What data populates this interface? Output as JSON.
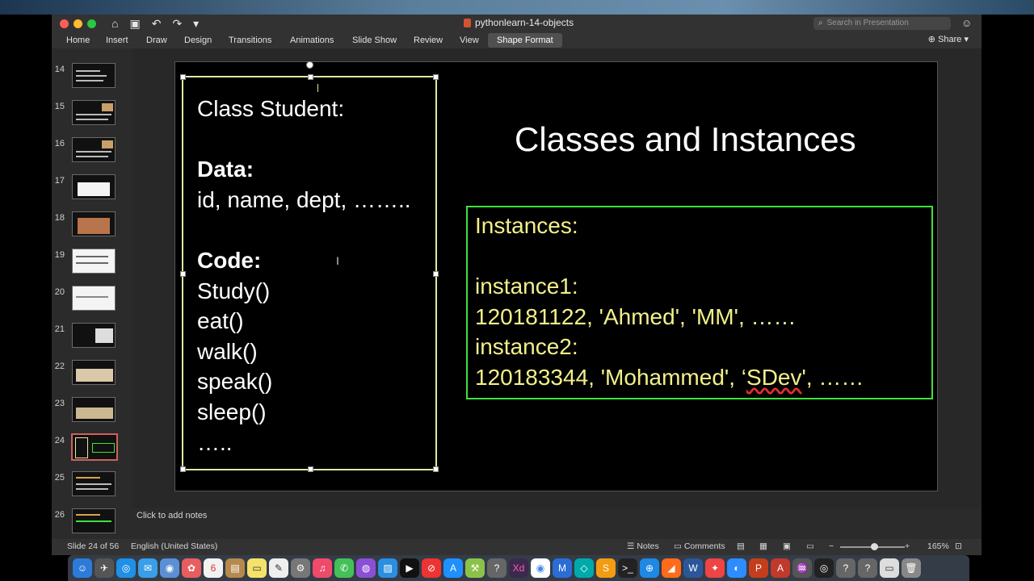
{
  "window": {
    "title": "pythonlearn-14-objects",
    "search_placeholder": "Search in Presentation",
    "share_label": "Share"
  },
  "quick_access": [
    "⌂",
    "▣",
    "↶",
    "↷",
    "▾"
  ],
  "tabs": [
    "Home",
    "Insert",
    "Draw",
    "Design",
    "Transitions",
    "Animations",
    "Slide Show",
    "Review",
    "View",
    "Shape Format"
  ],
  "active_tab": "Shape Format",
  "thumbnails": [
    {
      "num": "14"
    },
    {
      "num": "15"
    },
    {
      "num": "16"
    },
    {
      "num": "17"
    },
    {
      "num": "18"
    },
    {
      "num": "19"
    },
    {
      "num": "20"
    },
    {
      "num": "21"
    },
    {
      "num": "22"
    },
    {
      "num": "23"
    },
    {
      "num": "24"
    },
    {
      "num": "25"
    },
    {
      "num": "26"
    }
  ],
  "selected_slide": "24",
  "slide": {
    "title": "Classes and Instances",
    "left_box": {
      "class_line": "Class Student:",
      "data_heading": "Data:",
      "data_line": "id, name, dept, ……..",
      "code_heading": "Code:",
      "methods": [
        "Study()",
        "eat()",
        "walk()",
        "speak()",
        "sleep()",
        "….."
      ]
    },
    "instances_box": {
      "heading": "Instances:",
      "instance1_label": "instance1:",
      "instance1_value": "120181122, 'Ahmed', 'MM', ……",
      "instance2_label": "instance2:",
      "instance2_value_pre": "120183344, 'Mohammed', ‘",
      "instance2_value_sq": "SDev",
      "instance2_value_post": "', ……"
    }
  },
  "notes_placeholder": "Click to add notes",
  "status": {
    "slide_counter": "Slide 24 of 56",
    "language": "English (United States)",
    "notes_label": "Notes",
    "comments_label": "Comments",
    "zoom": "165%"
  },
  "colors": {
    "left_box_border": "#e2e8a0",
    "instances_border": "#3fe23d",
    "instances_text": "#f2f08a",
    "selected_thumb_border": "#d0605e"
  }
}
